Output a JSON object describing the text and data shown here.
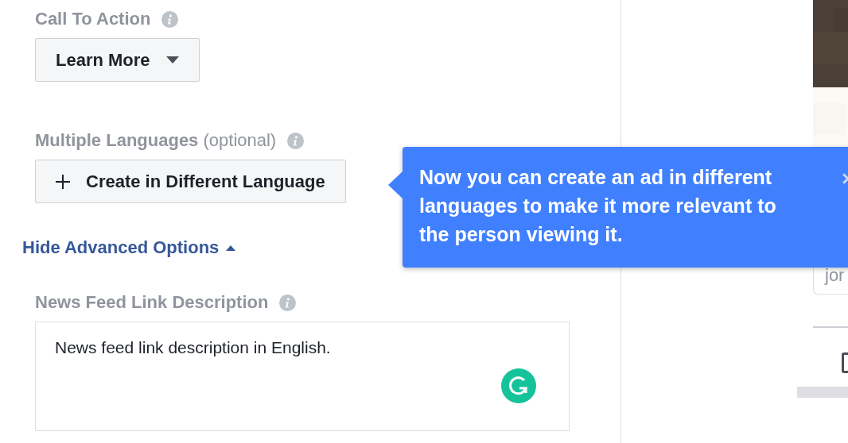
{
  "call_to_action": {
    "label": "Call To Action",
    "value": "Learn More"
  },
  "multiple_languages": {
    "label": "**Multiple Languages** (optional)",
    "button": "Create in Different Language"
  },
  "advanced_toggle": {
    "label": "Hide Advanced Options",
    "expanded": true
  },
  "news_feed_link_description": {
    "label": "News Feed Link Description",
    "value": "News feed link description in English."
  },
  "tooltip": {
    "lines": [
      "Now you can create an ad in different",
      "languages to make it more relevant to",
      "the person viewing it."
    ]
  },
  "preview": {
    "card_text": "jor"
  }
}
